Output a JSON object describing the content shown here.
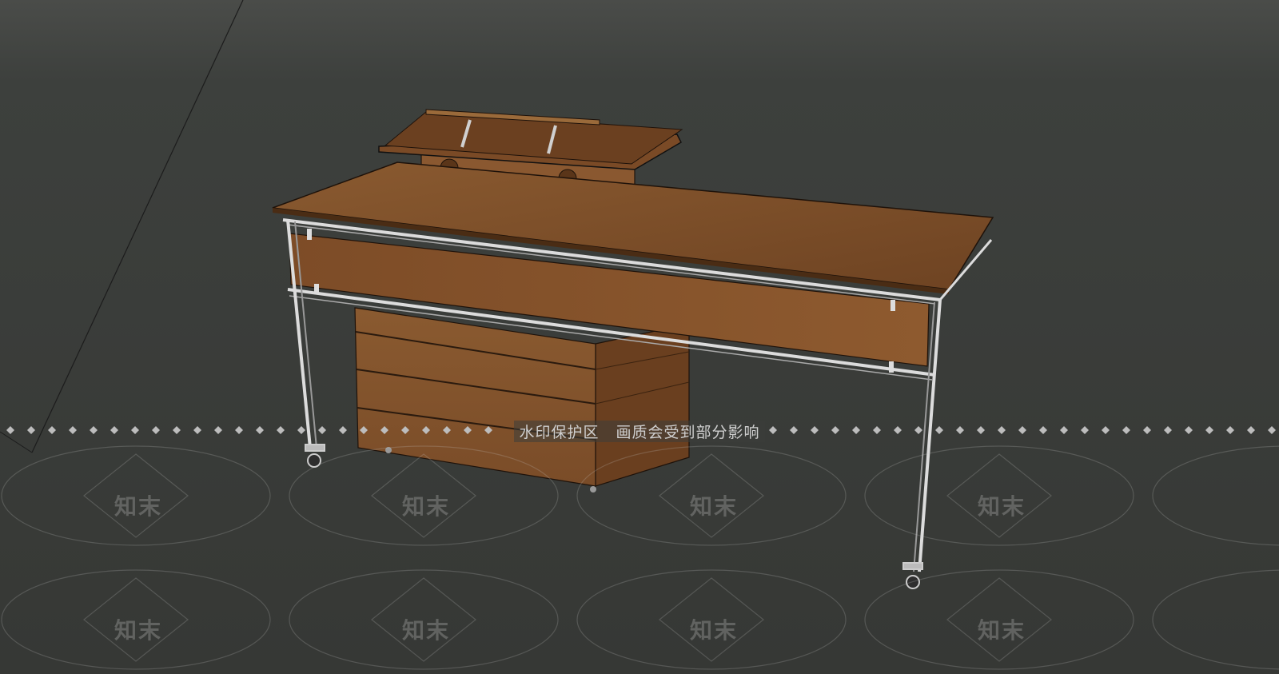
{
  "scene": {
    "subject": "wooden-desk-3d-model",
    "background_color": "#3a3c39",
    "wood_color": "#7a4a26",
    "metal_frame_color": "#d8d8d8"
  },
  "watermark": {
    "band_text": "水印保护区   画质会受到部分影响",
    "logo_text": "知末"
  }
}
